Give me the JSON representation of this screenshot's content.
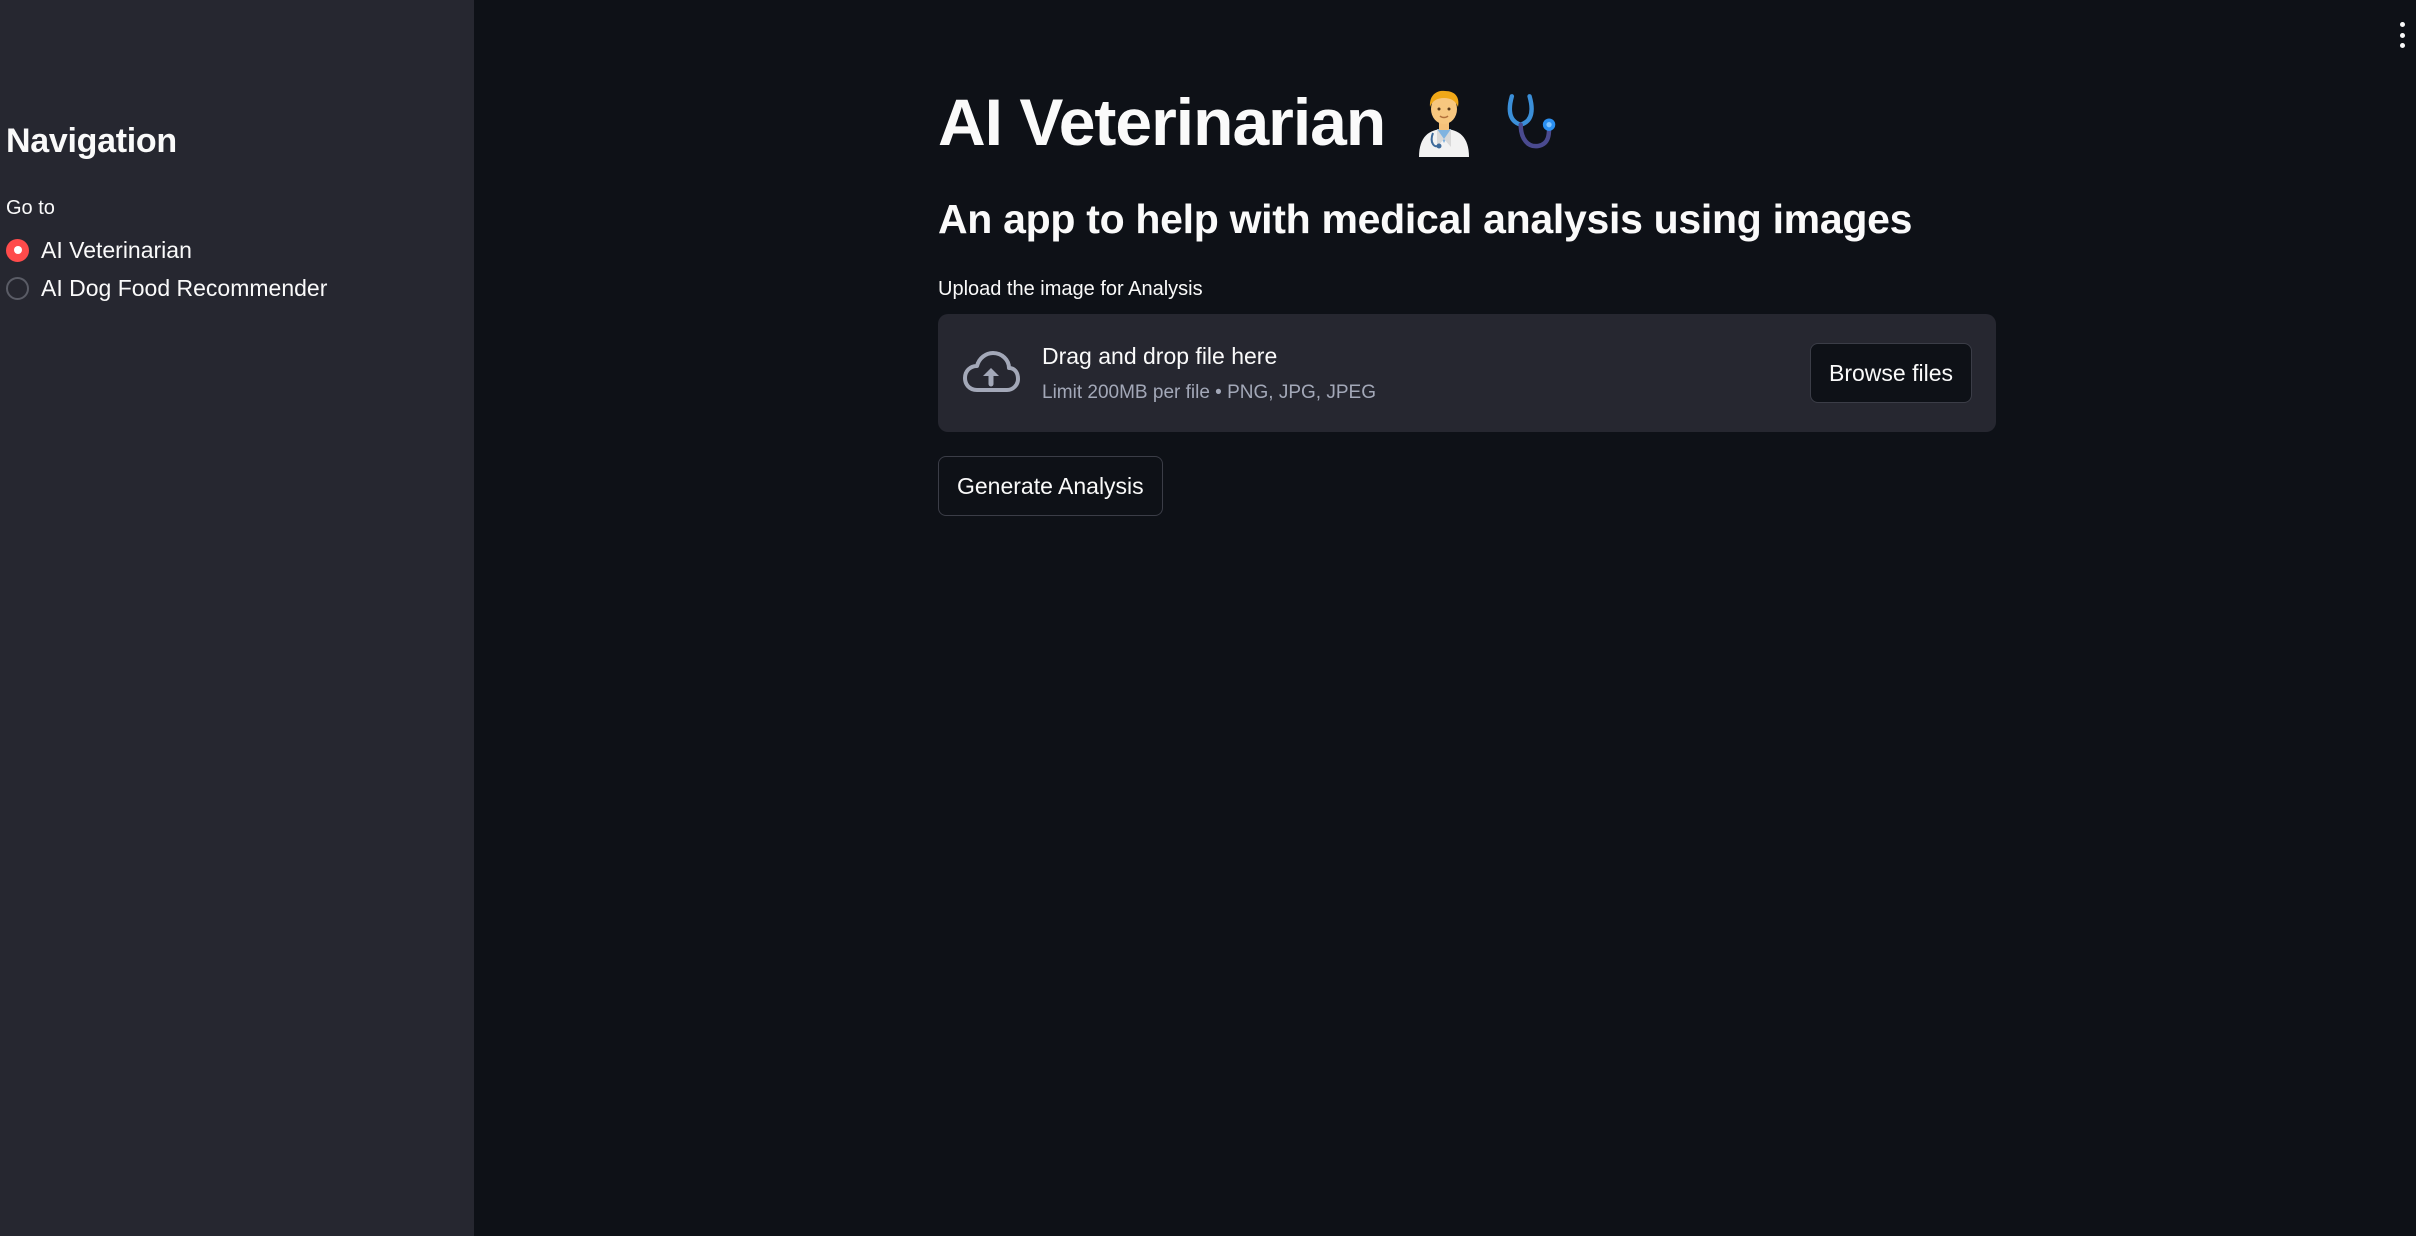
{
  "sidebar": {
    "title": "Navigation",
    "radio_label": "Go to",
    "options": [
      {
        "label": "AI Veterinarian",
        "selected": true
      },
      {
        "label": "AI Dog Food Recommender",
        "selected": false
      }
    ],
    "accent_color": "#ff4b4b"
  },
  "main": {
    "title": "AI Veterinarian",
    "title_icons": [
      "doctor-emoji-icon",
      "stethoscope-icon"
    ],
    "subtitle": "An app to help with medical analysis using images",
    "uploader": {
      "label": "Upload the image for Analysis",
      "drop_text": "Drag and drop file here",
      "limit_text": "Limit 200MB per file • PNG, JPG, JPEG",
      "browse_label": "Browse files",
      "icon": "cloud-upload-icon"
    },
    "generate_label": "Generate Analysis",
    "menu_icon": "kebab-menu-icon"
  },
  "colors": {
    "background": "#0e1117",
    "sidebar_background": "#262730",
    "text": "#fafafa"
  }
}
